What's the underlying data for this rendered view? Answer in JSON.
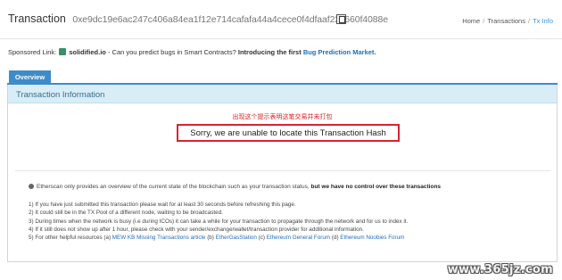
{
  "header": {
    "title": "Transaction",
    "hash": "0xe9dc19e6ac247c406a84ea1f12e714cafafa44a4cece0f4dfaaf22c660f4088e",
    "breadcrumb": [
      "Home",
      "Transactions",
      "Tx Info"
    ]
  },
  "sponsored": {
    "label": "Sponsored Link:",
    "brand": "solidified.io",
    "text": " - Can you predict bugs in Smart Contracts?",
    "bold_text": "Introducing the first",
    "link_text": "Bug Prediction Market."
  },
  "tabs": [
    "Overview"
  ],
  "panel": {
    "title": "Transaction Information",
    "annotation_cn": "出现这个提示表明这笔交易并未打包",
    "error_message": "Sorry, we are unable to locate this Transaction Hash"
  },
  "info": {
    "text": "Etherscan only provides an overview of the current state of the blockchain such as your transaction status,",
    "bold": "but we have no control over these transactions"
  },
  "steps": {
    "s1": "1) If you have just submitted this transaction please wait for at least 30 seconds before refreshing this page.",
    "s2": "2) It could still be in the TX Pool of a different node, waiting to be broadcasted.",
    "s3": "3) During times when the network is busy (i.e during ICOs) it can take a while for your transaction to propagate through the network and for us to index it.",
    "s4": "4) If it still does not show up after 1 hour, please check with your sender/exchange/wallet/transaction provider for additional information.",
    "s5_prefix": "5) For other helpful resources (a)",
    "link_a": "MEW KB Missing Transactions article",
    "b_prefix": "(b)",
    "link_b": "EtherGasStation",
    "c_prefix": "(c)",
    "link_c": "Ethereum General Forum",
    "d_prefix": "(d)",
    "link_d": "Ethereum Noobies Forum"
  },
  "watermark": "www.365jz.com",
  "icons": {
    "copy": "copy-icon",
    "info": "info-circle-icon",
    "brand": "solidified-logo-icon"
  },
  "colors": {
    "tab_active": "#3f8bc8",
    "panel_heading": "#d9edf7",
    "error_border": "#d9232f",
    "link": "#1e6fb8",
    "annotation": "#e02020"
  }
}
